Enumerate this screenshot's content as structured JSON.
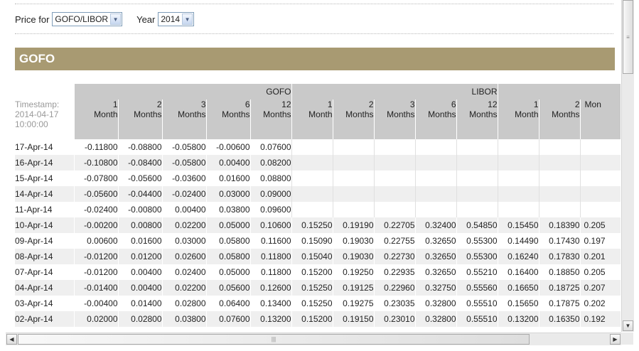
{
  "filters": {
    "price_label": "Price for",
    "price_value": "GOFO/LIBOR",
    "year_label": "Year",
    "year_value": "2014"
  },
  "section_title": "GOFO",
  "table": {
    "timestamp_label": "Timestamp:",
    "timestamp_date": "2014-04-17",
    "timestamp_time": "10:00:00",
    "groups": [
      "GOFO",
      "LIBOR"
    ],
    "columns": [
      [
        "1",
        "Month"
      ],
      [
        "2",
        "Months"
      ],
      [
        "3",
        "Months"
      ],
      [
        "6",
        "Months"
      ],
      [
        "12",
        "Months"
      ],
      [
        "1",
        "Month"
      ],
      [
        "2",
        "Months"
      ],
      [
        "3",
        "Months"
      ],
      [
        "6",
        "Months"
      ],
      [
        "12",
        "Months"
      ],
      [
        "1",
        "Month"
      ],
      [
        "2",
        "Months"
      ],
      [
        "",
        "Mon"
      ]
    ],
    "rows": [
      {
        "date": "17-Apr-14",
        "values": [
          "-0.11800",
          "-0.08800",
          "-0.05800",
          "-0.00600",
          "0.07600",
          "",
          "",
          "",
          "",
          "",
          "",
          "",
          ""
        ]
      },
      {
        "date": "16-Apr-14",
        "values": [
          "-0.10800",
          "-0.08400",
          "-0.05800",
          "0.00400",
          "0.08200",
          "",
          "",
          "",
          "",
          "",
          "",
          "",
          ""
        ]
      },
      {
        "date": "15-Apr-14",
        "values": [
          "-0.07800",
          "-0.05600",
          "-0.03600",
          "0.01600",
          "0.08800",
          "",
          "",
          "",
          "",
          "",
          "",
          "",
          ""
        ]
      },
      {
        "date": "14-Apr-14",
        "values": [
          "-0.05600",
          "-0.04400",
          "-0.02400",
          "0.03000",
          "0.09000",
          "",
          "",
          "",
          "",
          "",
          "",
          "",
          ""
        ]
      },
      {
        "date": "11-Apr-14",
        "values": [
          "-0.02400",
          "-0.00800",
          "0.00400",
          "0.03800",
          "0.09600",
          "",
          "",
          "",
          "",
          "",
          "",
          "",
          ""
        ]
      },
      {
        "date": "10-Apr-14",
        "values": [
          "-0.00200",
          "0.00800",
          "0.02200",
          "0.05000",
          "0.10600",
          "0.15250",
          "0.19190",
          "0.22705",
          "0.32400",
          "0.54850",
          "0.15450",
          "0.18390",
          "0.205"
        ]
      },
      {
        "date": "09-Apr-14",
        "values": [
          "0.00600",
          "0.01600",
          "0.03000",
          "0.05800",
          "0.11600",
          "0.15090",
          "0.19030",
          "0.22755",
          "0.32650",
          "0.55300",
          "0.14490",
          "0.17430",
          "0.197"
        ]
      },
      {
        "date": "08-Apr-14",
        "values": [
          "-0.01200",
          "0.01200",
          "0.02600",
          "0.05800",
          "0.11800",
          "0.15040",
          "0.19030",
          "0.22730",
          "0.32650",
          "0.55300",
          "0.16240",
          "0.17830",
          "0.201"
        ]
      },
      {
        "date": "07-Apr-14",
        "values": [
          "-0.01200",
          "0.00400",
          "0.02400",
          "0.05000",
          "0.11800",
          "0.15200",
          "0.19250",
          "0.22935",
          "0.32650",
          "0.55210",
          "0.16400",
          "0.18850",
          "0.205"
        ]
      },
      {
        "date": "04-Apr-14",
        "values": [
          "-0.01400",
          "0.00400",
          "0.02200",
          "0.05600",
          "0.12600",
          "0.15250",
          "0.19125",
          "0.22960",
          "0.32750",
          "0.55560",
          "0.16650",
          "0.18725",
          "0.207"
        ]
      },
      {
        "date": "03-Apr-14",
        "values": [
          "-0.00400",
          "0.01400",
          "0.02800",
          "0.06400",
          "0.13400",
          "0.15250",
          "0.19275",
          "0.23035",
          "0.32800",
          "0.55510",
          "0.15650",
          "0.17875",
          "0.202"
        ]
      },
      {
        "date": "02-Apr-14",
        "values": [
          "0.02000",
          "0.02800",
          "0.03800",
          "0.07600",
          "0.13200",
          "0.15200",
          "0.19150",
          "0.23010",
          "0.32800",
          "0.55510",
          "0.13200",
          "0.16350",
          "0.192"
        ]
      }
    ]
  },
  "icons": {
    "dropdown": "chevron-down-icon",
    "scroll_up": "arrow-up-icon",
    "scroll_down": "arrow-down-icon",
    "scroll_left": "arrow-left-icon",
    "scroll_right": "arrow-right-icon"
  },
  "colors": {
    "title_band": "#a89a72",
    "header_bg": "#c9c9c9",
    "alt_row": "#efefef"
  }
}
